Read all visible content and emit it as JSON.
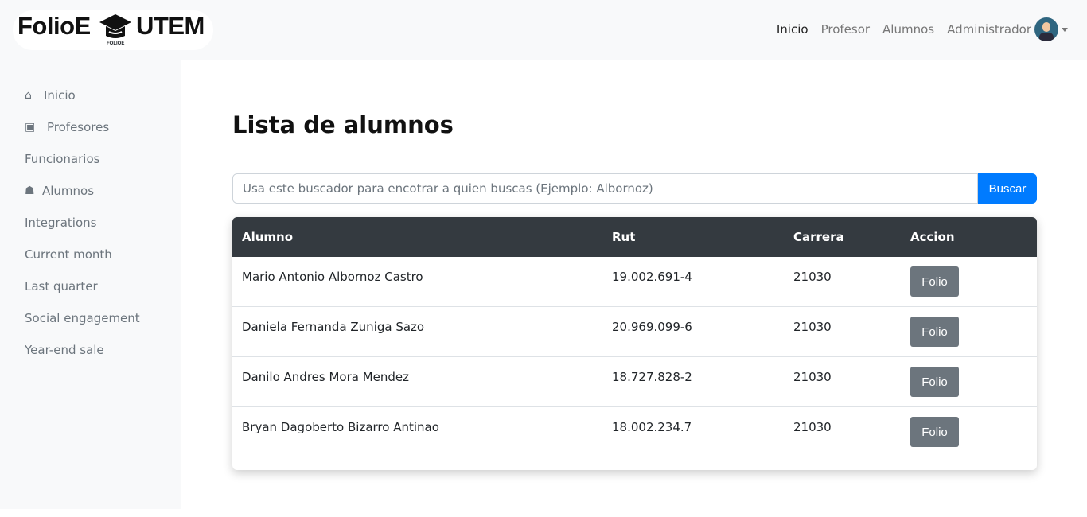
{
  "logo": {
    "left": "FolioE",
    "right": "UTEM",
    "sub": "FOLIOE"
  },
  "nav": {
    "items": [
      "Inicio",
      "Profesor",
      "Alumnos"
    ],
    "user": "Administrador"
  },
  "sidebar": {
    "items": [
      {
        "label": "Inicio",
        "icon": "home-icon"
      },
      {
        "label": "Profesores",
        "icon": "chalkboard-teacher-icon"
      },
      {
        "label": "Funcionarios"
      },
      {
        "label": "Alumnos",
        "icon": "user-graduate-icon"
      },
      {
        "label": "Integrations"
      },
      {
        "label": "Current month"
      },
      {
        "label": "Last quarter"
      },
      {
        "label": "Social engagement"
      },
      {
        "label": "Year-end sale"
      }
    ]
  },
  "main": {
    "title": "Lista de alumnos",
    "search_placeholder": "Usa este buscador para encotrar a quien buscas (Ejemplo: Albornoz)",
    "search_button": "Buscar",
    "columns": [
      "Alumno",
      "Rut",
      "Carrera",
      "Accion"
    ],
    "rows": [
      {
        "name": "Mario Antonio Albornoz Castro",
        "rut": "19.002.691-4",
        "carrera": "21030",
        "action": "Folio"
      },
      {
        "name": "Daniela Fernanda Zuniga Sazo",
        "rut": "20.969.099-6",
        "carrera": "21030",
        "action": "Folio"
      },
      {
        "name": "Danilo Andres Mora Mendez",
        "rut": "18.727.828-2",
        "carrera": "21030",
        "action": "Folio"
      },
      {
        "name": "Bryan Dagoberto Bizarro Antinao",
        "rut": "18.002.234.7",
        "carrera": "21030",
        "action": "Folio"
      }
    ]
  },
  "colors": {
    "primary": "#007bff",
    "secondary": "#6c757d",
    "table_head": "#343a40"
  }
}
